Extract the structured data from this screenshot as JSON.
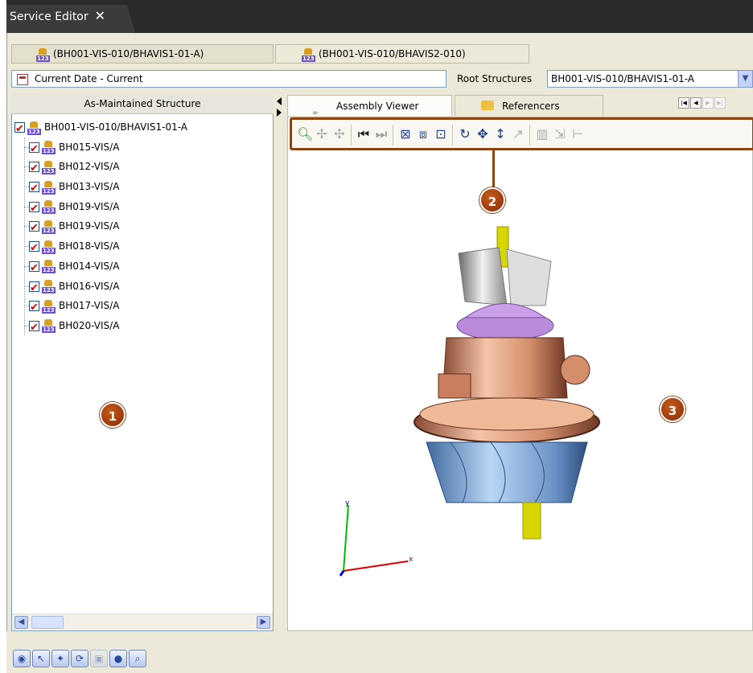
{
  "window": {
    "title": "Service Editor",
    "close_glyph": "✕"
  },
  "doc_tabs": [
    {
      "label": "(BH001-VIS-010/BHAVIS1-01-A)"
    },
    {
      "label": "(BH001-VIS-010/BHAVIS2-010)"
    }
  ],
  "filters": {
    "date_value": "Current Date - Current",
    "root_label": "Root Structures",
    "root_value": "BH001-VIS-010/BHAVIS1-01-A"
  },
  "structure_panel": {
    "header": "As-Maintained Structure",
    "root": "BH001-VIS-010/BHAVIS1-01-A",
    "items": [
      "BH015-VIS/A",
      "BH012-VIS/A",
      "BH013-VIS/A",
      "BH019-VIS/A",
      "BH019-VIS/A",
      "BH018-VIS/A",
      "BH014-VIS/A",
      "BH016-VIS/A",
      "BH017-VIS/A",
      "BH020-VIS/A"
    ]
  },
  "viewer_tabs": [
    {
      "label": "Assembly Viewer",
      "icon": "glasses-icon"
    },
    {
      "label": "Referencers",
      "icon": "folder-icon"
    }
  ],
  "toolbar_icons": [
    "zoom-icon",
    "pick-icon",
    "pick-part-icon",
    "first-icon",
    "last-icon",
    "fit-all-icon",
    "zoom-area-icon",
    "fit-icon",
    "rotate-icon",
    "pan-icon",
    "move-vertical-icon",
    "measure-icon",
    "align-icon",
    "disassemble-icon",
    "reset-icon"
  ],
  "callouts": [
    "1",
    "2",
    "3"
  ],
  "axes": {
    "x": "x",
    "y": "y"
  },
  "bottom_icons": [
    "navigate-icon",
    "select-icon",
    "filter-icon",
    "refresh-icon",
    "snapshot-icon",
    "color-icon",
    "search-icon"
  ],
  "colors": {
    "callout": "#a0410f",
    "title_bar": "#2a2a2a",
    "check": "#e00000"
  }
}
